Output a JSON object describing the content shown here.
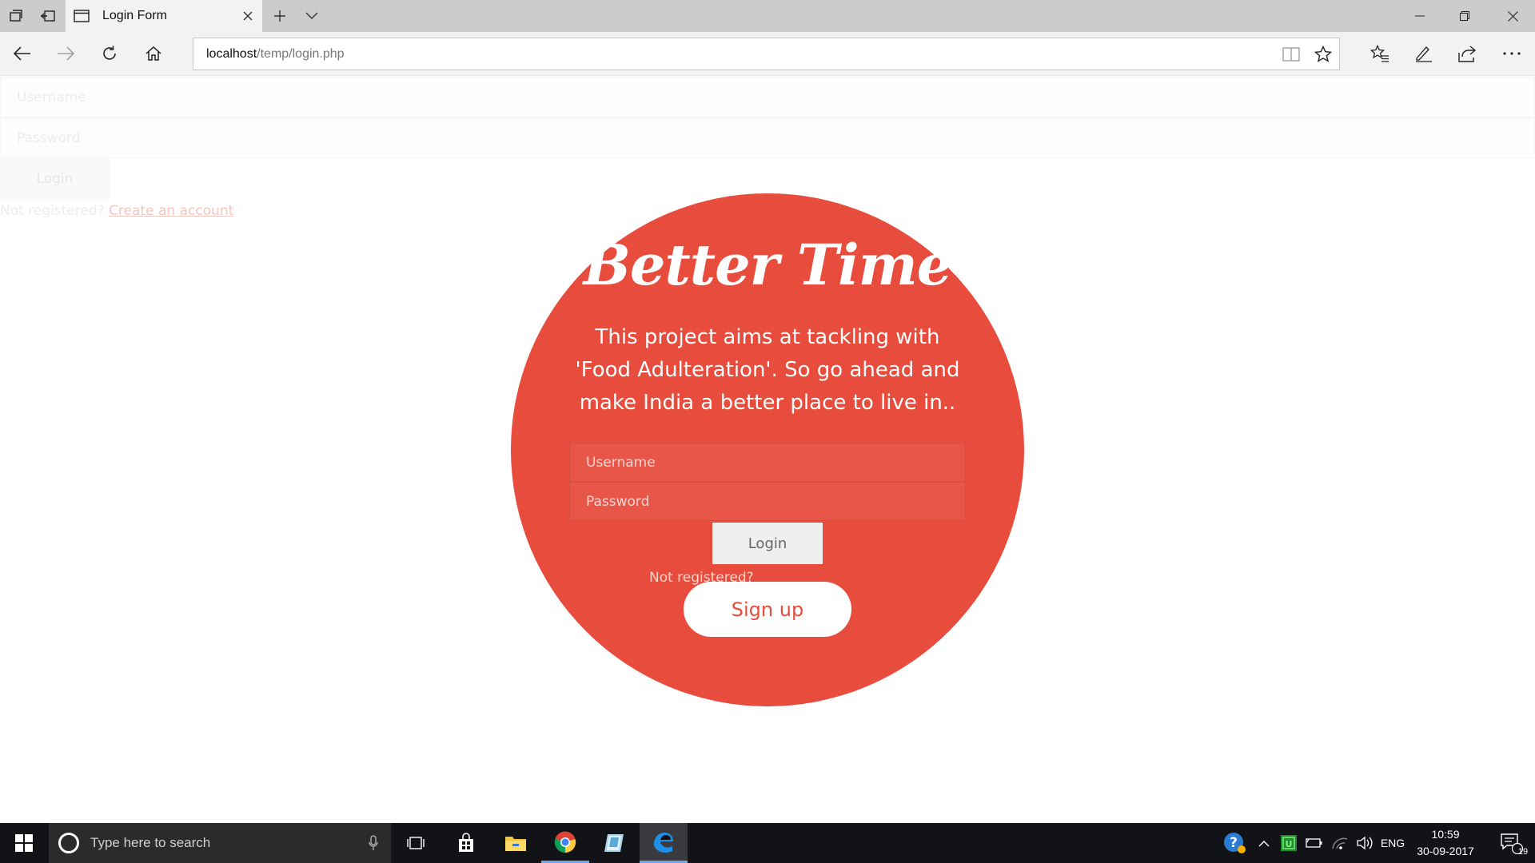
{
  "browser": {
    "tab": {
      "title": "Login Form"
    },
    "address": {
      "host": "localhost",
      "path": "/temp/login.php"
    }
  },
  "background_form": {
    "username_placeholder": "Username",
    "password_placeholder": "Password",
    "login_label": "Login",
    "not_registered": "Not registered?",
    "create_account": "Create an account"
  },
  "hero": {
    "brand": "Better Time",
    "description": "This project aims at tackling with 'Food Adulteration'. So go ahead and make India a better place to live in..",
    "username_placeholder": "Username",
    "password_placeholder": "Password",
    "login_label": "Login",
    "not_registered": "Not registered?",
    "signup_label": "Sign up"
  },
  "colors": {
    "accent": "#e74c3c",
    "tab_strip": "#cccccc",
    "taskbar": "#121316"
  },
  "taskbar": {
    "search_placeholder": "Type here to search",
    "language": "ENG",
    "time": "10:59",
    "date": "30-09-2017",
    "notification_count": "19",
    "apps": [
      "task-view",
      "store",
      "file-explorer",
      "chrome",
      "paint",
      "edge"
    ]
  }
}
